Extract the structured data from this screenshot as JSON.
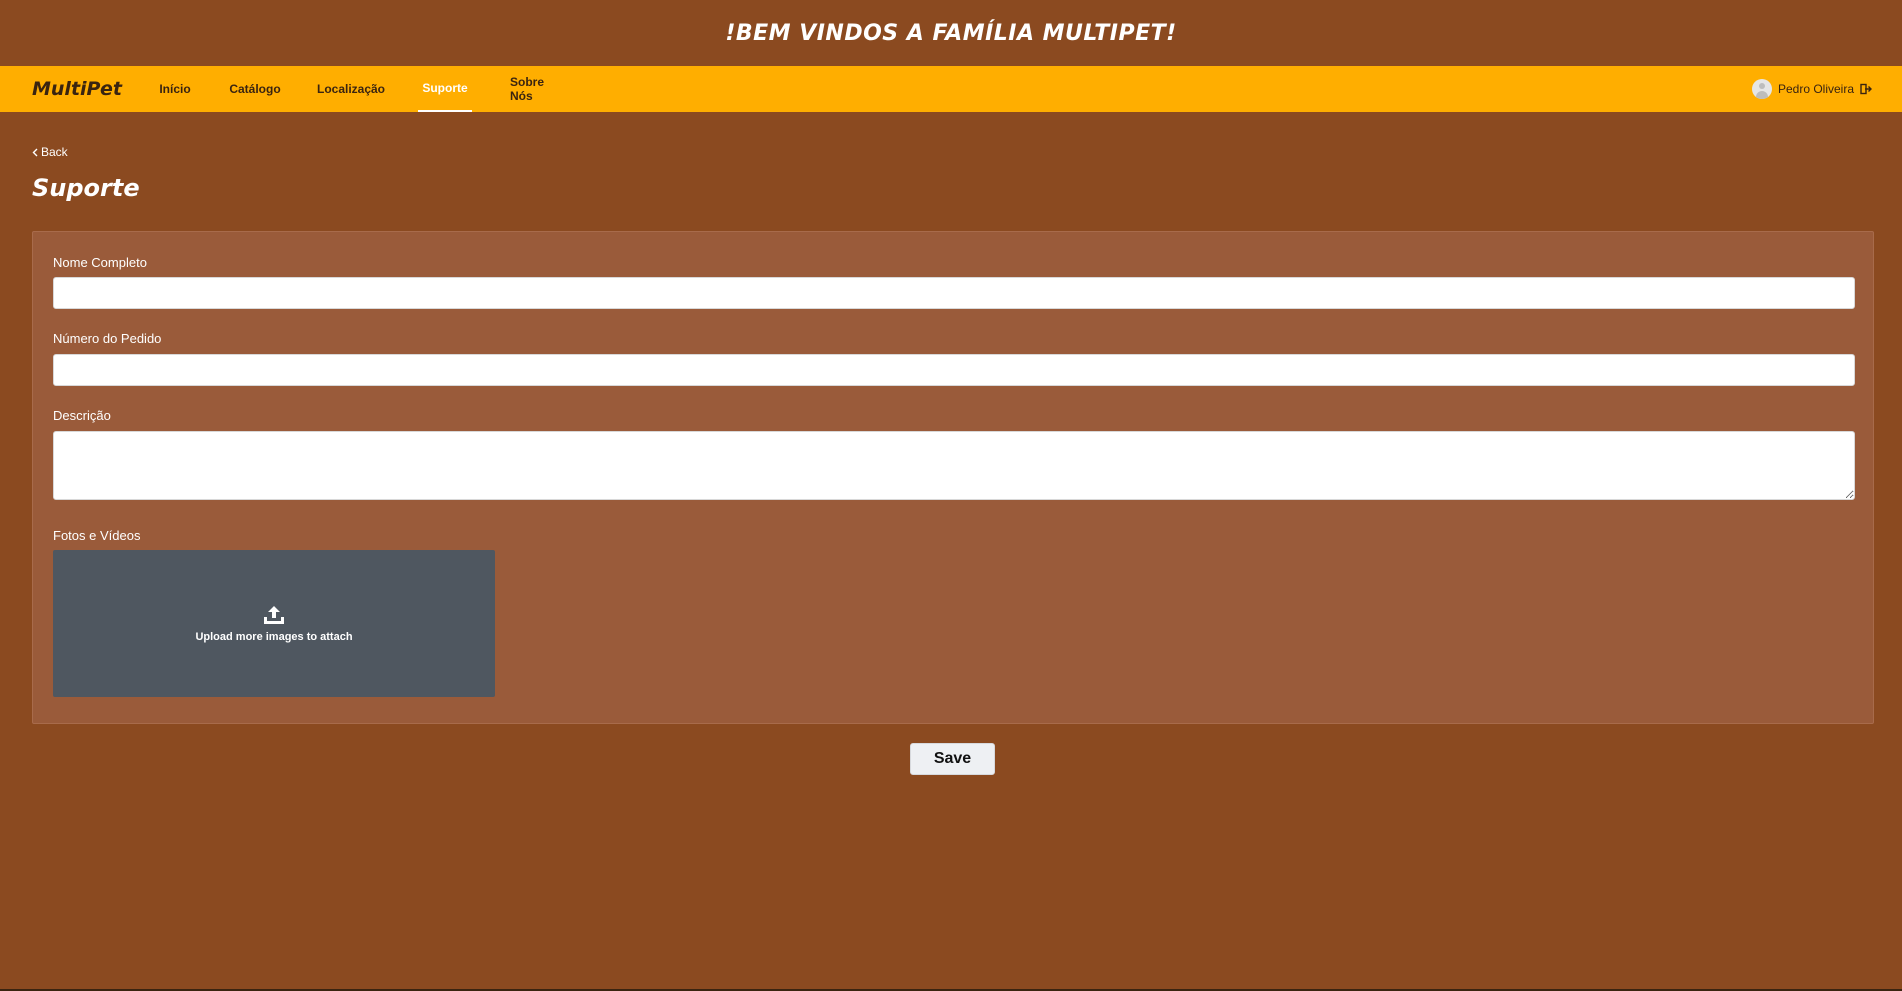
{
  "banner": {
    "text": "!BEM VINDOS A FAMÍLIA MULTIPET!"
  },
  "navbar": {
    "brand": "MultiPet",
    "items": [
      {
        "label": "Início"
      },
      {
        "label": "Catálogo"
      },
      {
        "label": "Localização"
      },
      {
        "label": "Suporte",
        "active": true
      },
      {
        "label": "Sobre Nós"
      }
    ],
    "user": {
      "name": "Pedro Oliveira"
    }
  },
  "page": {
    "back_label": "Back",
    "title": "Suporte"
  },
  "form": {
    "full_name": {
      "label": "Nome Completo",
      "value": "",
      "placeholder": ""
    },
    "order_number": {
      "label": "Número do Pedido",
      "value": "",
      "placeholder": ""
    },
    "description": {
      "label": "Descrição",
      "value": "",
      "placeholder": ""
    },
    "media": {
      "label": "Fotos e Vídeos",
      "upload_text": "Upload more images to attach"
    },
    "save_label": "Save"
  },
  "colors": {
    "page_background": "#8B4A20",
    "navbar_background": "#FFAE00",
    "panel_background": "#9A5B3A",
    "upload_background": "#4F5760",
    "brand_text": "#3a2410"
  },
  "icons": {
    "avatar": "user-avatar-icon",
    "logout": "logout-icon",
    "back": "chevron-left-icon",
    "upload": "upload-icon"
  }
}
